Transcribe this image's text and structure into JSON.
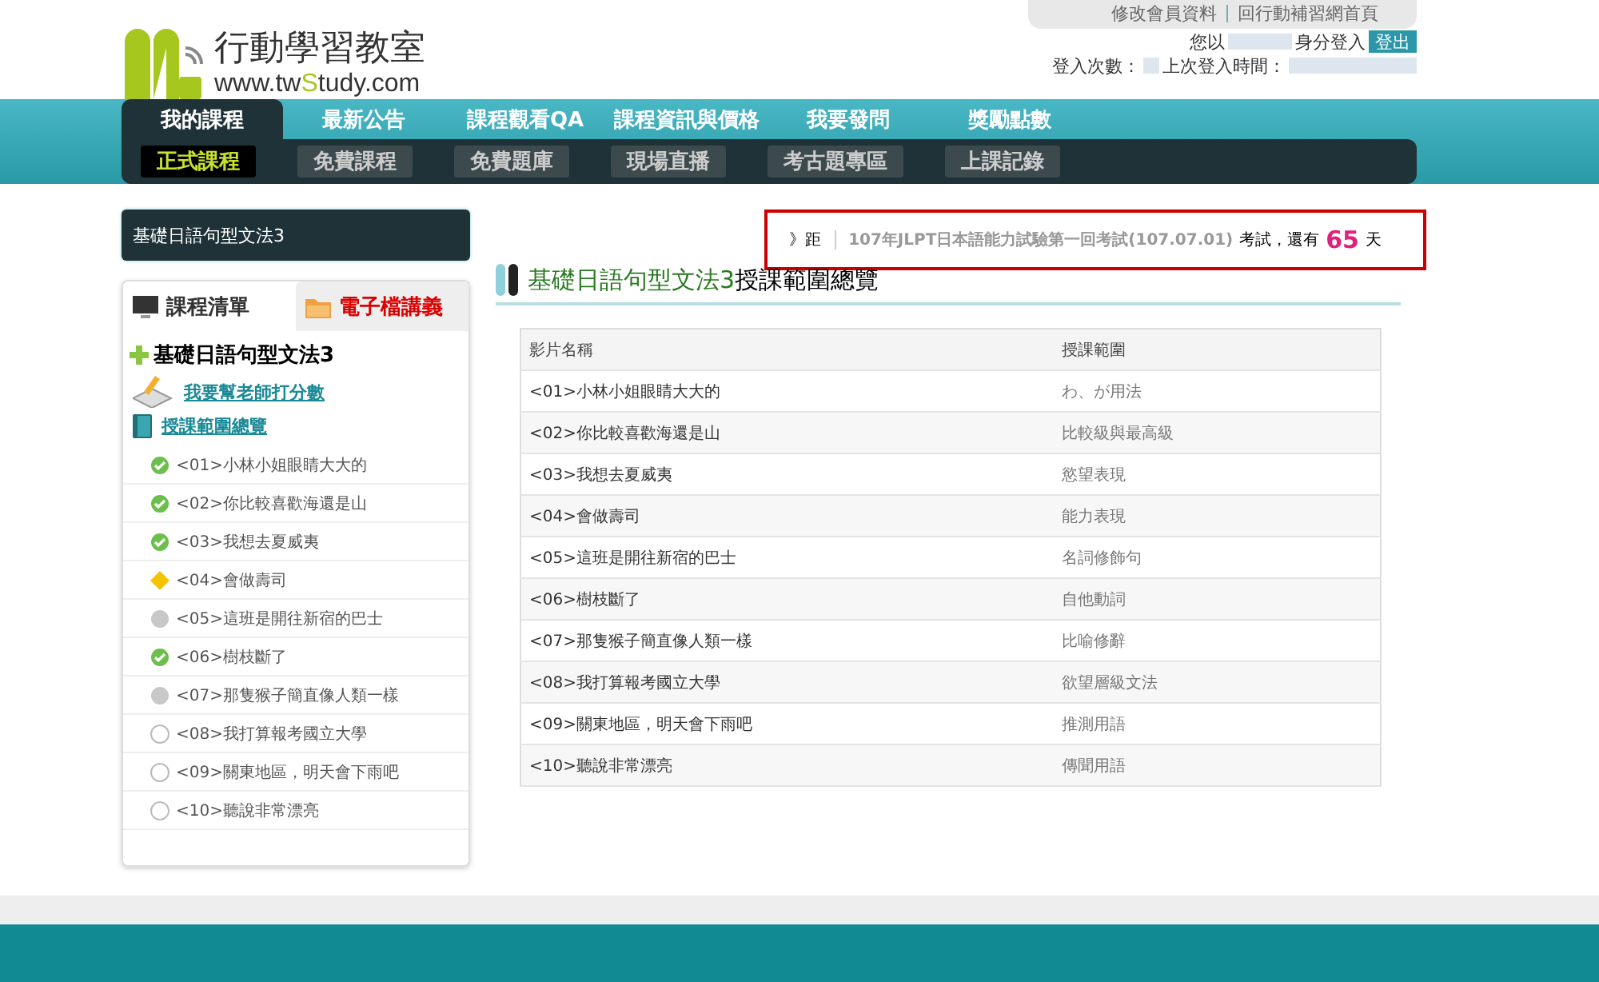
{
  "logo": {
    "title": "行動學習教室",
    "url_parts": [
      "www.tw",
      "S",
      "tudy.com"
    ]
  },
  "top_links": [
    "修改會員資料",
    "回行動補習網首頁"
  ],
  "login": {
    "prefix": "您以",
    "suffix": "身分登入",
    "logout": "登出",
    "count_label": "登入次數：",
    "last_label": "上次登入時間："
  },
  "main_nav": [
    {
      "label": "我的課程",
      "selected": true
    },
    {
      "label": "最新公告",
      "selected": false
    },
    {
      "label": "課程觀看QA",
      "selected": false
    },
    {
      "label": "課程資訊與價格",
      "selected": false
    },
    {
      "label": "我要發問",
      "selected": false
    },
    {
      "label": "獎勵點數",
      "selected": false
    }
  ],
  "sub_nav": [
    {
      "label": "正式課程",
      "selected": true
    },
    {
      "label": "免費課程",
      "selected": false
    },
    {
      "label": "免費題庫",
      "selected": false
    },
    {
      "label": "現場直播",
      "selected": false
    },
    {
      "label": "考古題專區",
      "selected": false
    },
    {
      "label": "上課記錄",
      "selected": false
    }
  ],
  "sidebar": {
    "course_title": "基礎日語句型文法3",
    "tabs": [
      {
        "label": "課程清單",
        "selected": true
      },
      {
        "label": "電子檔講義",
        "selected": false
      }
    ],
    "course_name": "基礎日語句型文法3",
    "links": [
      {
        "label": "我要幫老師打分數",
        "kind": "rate"
      },
      {
        "label": "授課範圍總覽",
        "kind": "overview"
      }
    ],
    "lessons": [
      {
        "title": "<01>小林小姐眼睛大大的",
        "kind": "done"
      },
      {
        "title": "<02>你比較喜歡海還是山",
        "kind": "done"
      },
      {
        "title": "<03>我想去夏威夷",
        "kind": "done"
      },
      {
        "title": "<04>會做壽司",
        "kind": "partial"
      },
      {
        "title": "<05>這班是開往新宿的巴士",
        "kind": "started"
      },
      {
        "title": "<06>樹枝斷了",
        "kind": "done"
      },
      {
        "title": "<07>那隻猴子簡直像人類一樣",
        "kind": "started"
      },
      {
        "title": "<08>我打算報考國立大學",
        "kind": "unwatched"
      },
      {
        "title": "<09>關東地區，明天會下雨吧",
        "kind": "unwatched"
      },
      {
        "title": "<10>聽說非常漂亮",
        "kind": "unwatched"
      }
    ]
  },
  "notice": {
    "marker": "》距",
    "exam": "107年JLPT日本語能力試驗第一回考試(107.07.01)",
    "middle": "考試，還有",
    "days": "65",
    "unit": "天",
    "highlighted": true
  },
  "page_title": {
    "course": "基礎日語句型文法3",
    "rest": "授課範圍總覽"
  },
  "table": {
    "columns": [
      "影片名稱",
      "授課範圍"
    ],
    "rows": [
      [
        "<01>小林小姐眼睛大大的",
        "わ、が用法"
      ],
      [
        "<02>你比較喜歡海還是山",
        "比較級與最高級"
      ],
      [
        "<03>我想去夏威夷",
        "慾望表現"
      ],
      [
        "<04>會做壽司",
        "能力表現"
      ],
      [
        "<05>這班是開往新宿的巴士",
        "名詞修飾句"
      ],
      [
        "<06>樹枝斷了",
        "自他動詞"
      ],
      [
        "<07>那隻猴子簡直像人類一樣",
        "比喻修辭"
      ],
      [
        "<08>我打算報考國立大學",
        "欲望層級文法"
      ],
      [
        "<09>關東地區，明天會下雨吧",
        "推測用語"
      ],
      [
        "<10>聽說非常漂亮",
        "傳聞用語"
      ]
    ]
  }
}
